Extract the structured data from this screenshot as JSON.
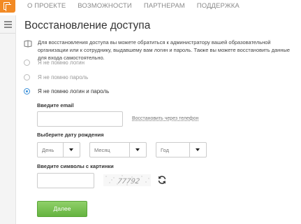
{
  "nav": {
    "items": [
      "О ПРОЕКТЕ",
      "ВОЗМОЖНОСТИ",
      "ПАРТНЕРАМ",
      "ПОДДЕРЖКА"
    ]
  },
  "page": {
    "title": "Восстановление доступа",
    "info": "Для восстановления доступа вы можете обратиться к администратору вашей образовательной организации или к сотруднику, выдавшему вам логин и пароль. Также вы можете восстановить данные для входа самостоятельно."
  },
  "options": [
    {
      "label": "Я не помню логин",
      "checked": false
    },
    {
      "label": "Я не помню пароль",
      "checked": false
    },
    {
      "label": "Я не помню логин и пароль",
      "checked": true
    }
  ],
  "form": {
    "email_label": "Введите email",
    "email_value": "",
    "phone_link": "Восстановить через телефон",
    "dob_label": "Выберите дату рождения",
    "day": "День",
    "month": "Месяц",
    "year": "Год",
    "captcha_label": "Введите символы с картинки",
    "captcha_text": "77792",
    "captcha_value": "",
    "submit": "Далее"
  },
  "colors": {
    "accent": "#f28a24",
    "button": "#75c04e",
    "radio_selected": "#3a8fd8"
  },
  "icons": {
    "logo": "book-logo-icon",
    "menu": "hamburger-icon",
    "info": "book-icon",
    "refresh": "refresh-icon"
  }
}
